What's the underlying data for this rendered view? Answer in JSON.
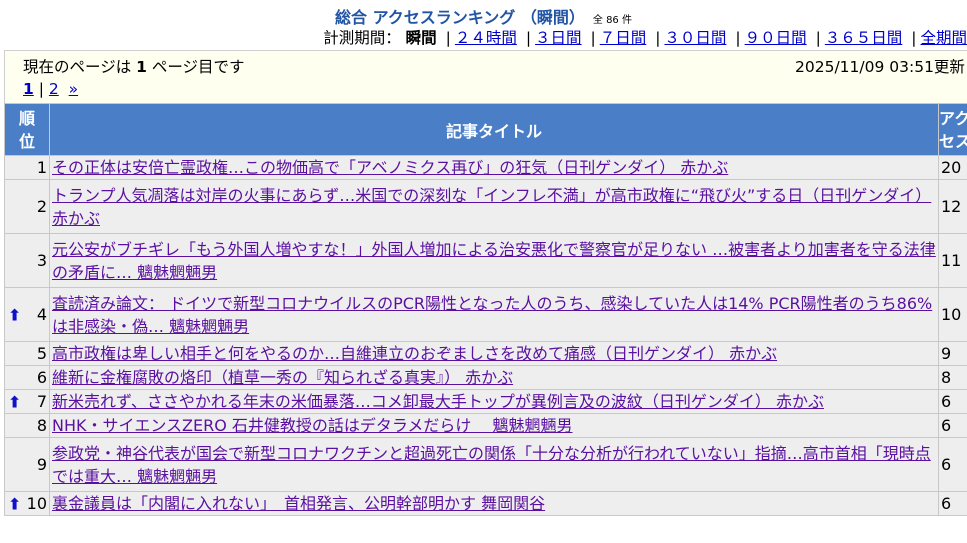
{
  "header": {
    "title": "総合 アクセスランキング （瞬間）",
    "count": "全 86 件"
  },
  "period": {
    "label": "計測期間：",
    "current": "瞬間",
    "links": [
      "２４時間",
      "３日間",
      "７日間",
      "３０日間",
      "９０日間",
      "３６５日間",
      "全期間"
    ]
  },
  "info": {
    "page_text": "現在のページは 1 ページ目です",
    "updated": "2025/11/09 03:51更新",
    "pager_current": "1",
    "pager_links": [
      "2",
      "»"
    ],
    "pager_sep": "|"
  },
  "table": {
    "headers": {
      "rank": "順位",
      "title": "記事タイトル",
      "access": "アクセス数"
    },
    "rows": [
      {
        "rank": "1",
        "up": false,
        "title": "その正体は安倍亡霊政権…この物価高で「アベノミクス再び」の狂気（日刊ゲンダイ） 赤かぶ",
        "access": "20"
      },
      {
        "rank": "2",
        "up": false,
        "title": "トランプ人気凋落は対岸の火事にあらず…米国での深刻な「インフレ不満」が高市政権に“飛び火”する日（日刊ゲンダイ） 赤かぶ",
        "access": "12"
      },
      {
        "rank": "3",
        "up": false,
        "title": "元公安がブチギレ「もう外国人増やすな！」外国人増加による治安悪化で警察官が足りない …被害者より加害者を守る法律の矛盾に… 魑魅魍魎男",
        "access": "11"
      },
      {
        "rank": "4",
        "up": true,
        "title": "査読済み論文： ドイツで新型コロナウイルスのPCR陽性となった人のうち、感染していた人は14% PCR陽性者のうち86%は非感染・偽… 魑魅魍魎男",
        "access": "10"
      },
      {
        "rank": "5",
        "up": false,
        "title": "高市政権は卑しい相手と何をやるのか…自維連立のおぞましさを改めて痛感（日刊ゲンダイ） 赤かぶ",
        "access": "9"
      },
      {
        "rank": "6",
        "up": false,
        "title": "維新に金権腐敗の烙印（植草一秀の『知られざる真実』） 赤かぶ",
        "access": "8"
      },
      {
        "rank": "7",
        "up": true,
        "title": "新米売れず、ささやかれる年末の米価暴落…コメ卸最大手トップが異例言及の波紋（日刊ゲンダイ） 赤かぶ",
        "access": "6"
      },
      {
        "rank": "8",
        "up": false,
        "title": "NHK・サイエンスZERO 石井健教授の話はデタラメだらけ　 魑魅魍魎男",
        "access": "6"
      },
      {
        "rank": "9",
        "up": false,
        "title": "参政党・神谷代表が国会で新型コロナワクチンと超過死亡の関係「十分な分析が行われていない」指摘…高市首相「現時点では重大… 魑魅魍魎男",
        "access": "6"
      },
      {
        "rank": "10",
        "up": true,
        "title": "裏金議員は「内閣に入れない」　首相発言、公明幹部明かす 舞岡関谷",
        "access": "6"
      }
    ]
  },
  "icons": {
    "up": "up-arrow-icon"
  },
  "colors": {
    "header_bg": "#4a7fc8",
    "title_text": "#2255a4",
    "link": "#5a10a0",
    "up_arrow": "#1010c8",
    "info_bg": "#fffff0",
    "row_bg": "#eeeeee"
  }
}
